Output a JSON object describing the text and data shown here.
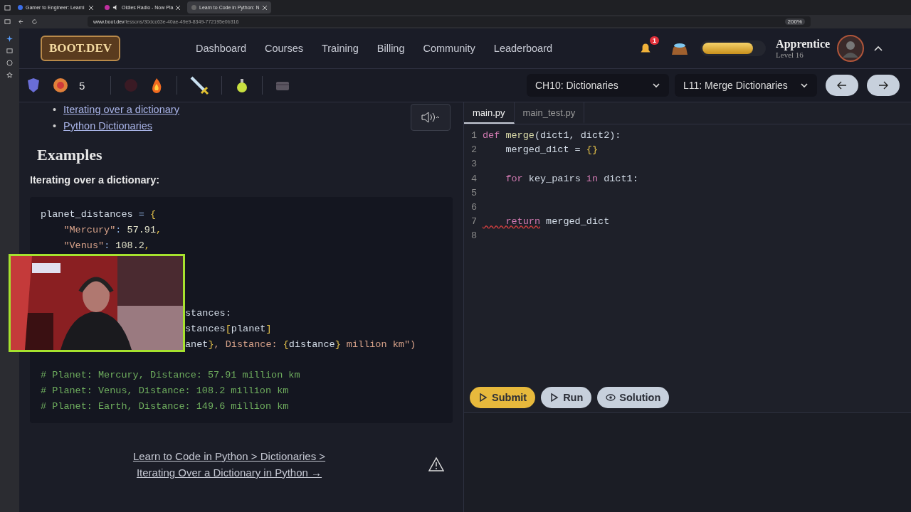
{
  "browser": {
    "tabs": [
      {
        "title": "Gamer to Engineer: Learni",
        "selected": false,
        "audio": false
      },
      {
        "title": "Oldies Radio - Now Pla",
        "selected": false,
        "audio": true
      },
      {
        "title": "Learn to Code in Python: N",
        "selected": true,
        "audio": false
      }
    ],
    "url_host": "www.boot.dev",
    "url_path": "/lessons/30dcc63e-40ae-49e9-8349-772195e0b316",
    "zoom": "200%"
  },
  "header": {
    "logo": "BOOT.DEV",
    "nav": [
      "Dashboard",
      "Courses",
      "Training",
      "Billing",
      "Community",
      "Leaderboard"
    ],
    "notifications": "1",
    "xp": {
      "level": 0.82
    },
    "rank": "Apprentice",
    "level": "Level 16"
  },
  "toolbar": {
    "streak": "5",
    "chapter": "CH10: Dictionaries",
    "lesson": "L11: Merge Dictionaries"
  },
  "lesson": {
    "links": [
      {
        "bullet": "•",
        "text": "Iterating over a dictionary"
      },
      {
        "bullet": "•",
        "text": "Python Dictionaries"
      }
    ],
    "heading": "Examples",
    "subheading": "Iterating over a dictionary:",
    "code_above": [
      [
        {
          "t": "planet_distances ",
          "kind": "name"
        },
        {
          "t": "= ",
          "kind": "operator"
        },
        {
          "t": "{",
          "kind": "bracket"
        }
      ],
      [
        {
          "t": "    \"Mercury\"",
          "kind": "string"
        },
        {
          "t": ": ",
          "kind": "operator"
        },
        {
          "t": "57.91",
          "kind": "number"
        },
        {
          "t": ",",
          "kind": "bracket"
        }
      ],
      [
        {
          "t": "    \"Venus\"",
          "kind": "string"
        },
        {
          "t": ": ",
          "kind": "operator"
        },
        {
          "t": "108.2",
          "kind": "number"
        },
        {
          "t": ",",
          "kind": "bracket"
        }
      ]
    ],
    "code_beside_webcam": [
      [
        {
          "t": "stances:",
          "kind": "name"
        }
      ],
      [
        {
          "t": "stances",
          "kind": "name"
        },
        {
          "t": "[",
          "kind": "bracket"
        },
        {
          "t": "planet",
          "kind": "name"
        },
        {
          "t": "]",
          "kind": "bracket"
        }
      ],
      [
        {
          "t": "anet",
          "kind": "name"
        },
        {
          "t": "}",
          "kind": "bracket"
        },
        {
          "t": ", Distance: ",
          "kind": "string"
        },
        {
          "t": "{",
          "kind": "bracket"
        },
        {
          "t": "distance",
          "kind": "name"
        },
        {
          "t": "}",
          "kind": "bracket"
        },
        {
          "t": " million km\")",
          "kind": "string"
        }
      ]
    ],
    "code_below": [
      [
        {
          "t": "# Planet: Mercury, Distance: 57.91 million km",
          "kind": "comment"
        }
      ],
      [
        {
          "t": "# Planet: Venus, Distance: 108.2 million km",
          "kind": "comment"
        }
      ],
      [
        {
          "t": "# Planet: Earth, Distance: 149.6 million km",
          "kind": "comment"
        }
      ]
    ],
    "breadcrumb": [
      "Learn to Code in Python > Dictionaries >",
      "Iterating Over a Dictionary in Python →"
    ]
  },
  "editor": {
    "files": [
      {
        "name": "main.py",
        "selected": true
      },
      {
        "name": "main_test.py",
        "selected": false
      }
    ],
    "lines": [
      {
        "no": "1",
        "tokens": [
          {
            "t": "def ",
            "kind": "keyword"
          },
          {
            "t": "merge",
            "kind": "function"
          },
          {
            "t": "(dict1, dict2):",
            "kind": "name"
          }
        ]
      },
      {
        "no": "2",
        "tokens": [
          {
            "t": "    merged_dict = ",
            "kind": "name"
          },
          {
            "t": "{}",
            "kind": "bracket"
          }
        ]
      },
      {
        "no": "3"
      },
      {
        "no": "4",
        "tokens": [
          {
            "t": "    for",
            "kind": "keyword"
          },
          {
            "t": " key_pairs ",
            "kind": "name"
          },
          {
            "t": "in",
            "kind": "keyword"
          },
          {
            "t": " dict1:",
            "kind": "name"
          }
        ]
      },
      {
        "no": "5"
      },
      {
        "no": "6"
      },
      {
        "no": "7",
        "tokens": [
          {
            "t": "    return",
            "kind": "error"
          },
          {
            "t": " merged_dict",
            "kind": "name"
          }
        ]
      },
      {
        "no": "8"
      }
    ],
    "buttons": [
      {
        "label": "Submit",
        "kind": "submit"
      },
      {
        "label": "Run",
        "kind": "run"
      },
      {
        "label": "Solution",
        "kind": "solution"
      }
    ]
  }
}
